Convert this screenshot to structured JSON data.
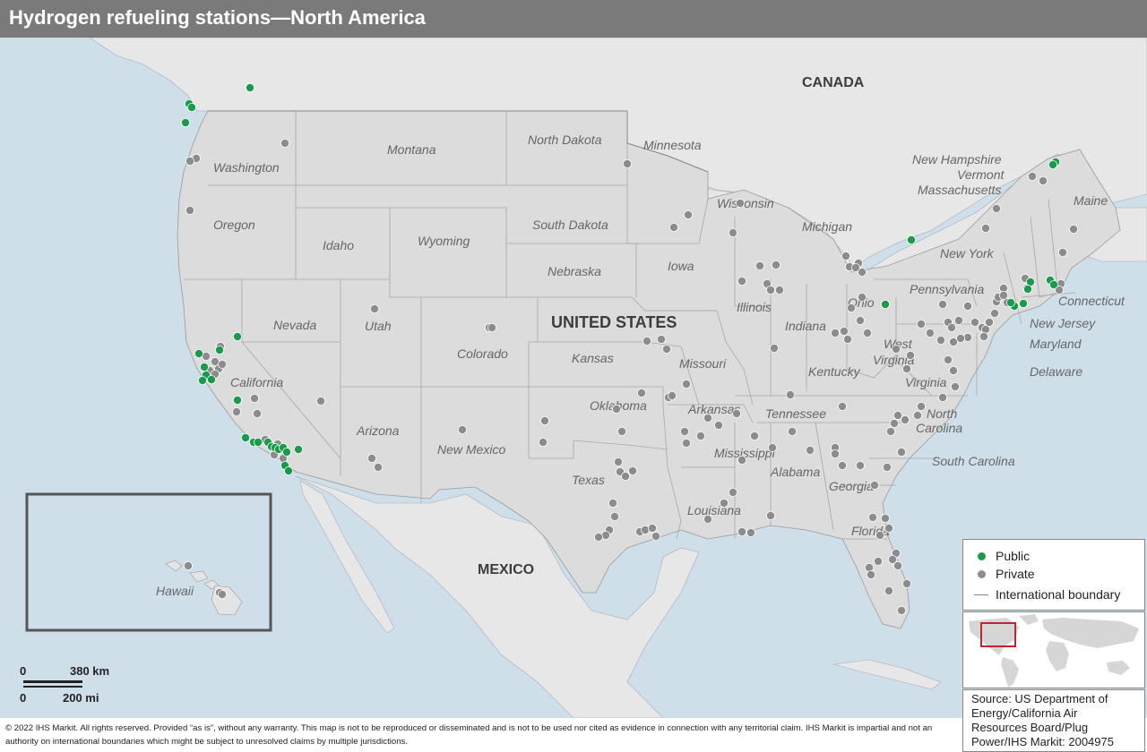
{
  "title": "Hydrogen refueling stations—North America",
  "countries": {
    "canada": "CANADA",
    "united_states": "UNITED STATES",
    "mexico": "MEXICO"
  },
  "states": {
    "washington": "Washington",
    "oregon": "Oregon",
    "california": "California",
    "idaho": "Idaho",
    "nevada": "Nevada",
    "montana": "Montana",
    "wyoming": "Wyoming",
    "utah": "Utah",
    "arizona": "Arizona",
    "colorado": "Colorado",
    "new_mexico": "New Mexico",
    "north_dakota": "North Dakota",
    "south_dakota": "South Dakota",
    "nebraska": "Nebraska",
    "kansas": "Kansas",
    "oklahoma": "Oklahoma",
    "texas": "Texas",
    "minnesota": "Minnesota",
    "iowa": "Iowa",
    "missouri": "Missouri",
    "arkansas": "Arkansas",
    "louisiana": "Louisiana",
    "wisconsin": "Wisconsin",
    "illinois": "Illinois",
    "michigan": "Michigan",
    "indiana": "Indiana",
    "ohio": "Ohio",
    "kentucky": "Kentucky",
    "tennessee": "Tennessee",
    "mississippi": "Mississippi",
    "alabama": "Alabama",
    "georgia": "Georgia",
    "florida": "Florida",
    "south_carolina": "South Carolina",
    "north_carolina_1": "North",
    "north_carolina_2": "Carolina",
    "virginia": "Virginia",
    "west_virginia_1": "West",
    "west_virginia_2": "Virginia",
    "pennsylvania": "Pennsylvania",
    "new_york": "New York",
    "maine": "Maine",
    "new_hampshire": "New Hampshire",
    "vermont": "Vermont",
    "massachusetts": "Massachusetts",
    "connecticut": "Connecticut",
    "new_jersey": "New Jersey",
    "maryland": "Maryland",
    "delaware": "Delaware",
    "hawaii": "Hawaii"
  },
  "legend": {
    "public": "Public",
    "private": "Private",
    "boundary": "International boundary"
  },
  "colors": {
    "public": "#1a9b4b",
    "private": "#8c8c8c",
    "ocean": "#cfdfe9",
    "land": "#e6e6e6",
    "us_land": "#dcdcdc",
    "title_bar": "#7a7a7a"
  },
  "scale": {
    "km_zero": "0",
    "km_label": "380 km",
    "mi_zero": "0",
    "mi_label": "200 mi"
  },
  "source": "Source: US Department of Energy/California Air Resources Board/Plug Power/IHS Markit: 2004975",
  "copyright": "© 2022 IHS Markit. All rights reserved. Provided “as is”, without any warranty. This map is not to be reproduced or disseminated and is not to be used nor cited as evidence in connection with any territorial claim. IHS Markit is impartial and not an authority on international boundaries which might be subject to unresolved claims by multiple jurisdictions."
}
